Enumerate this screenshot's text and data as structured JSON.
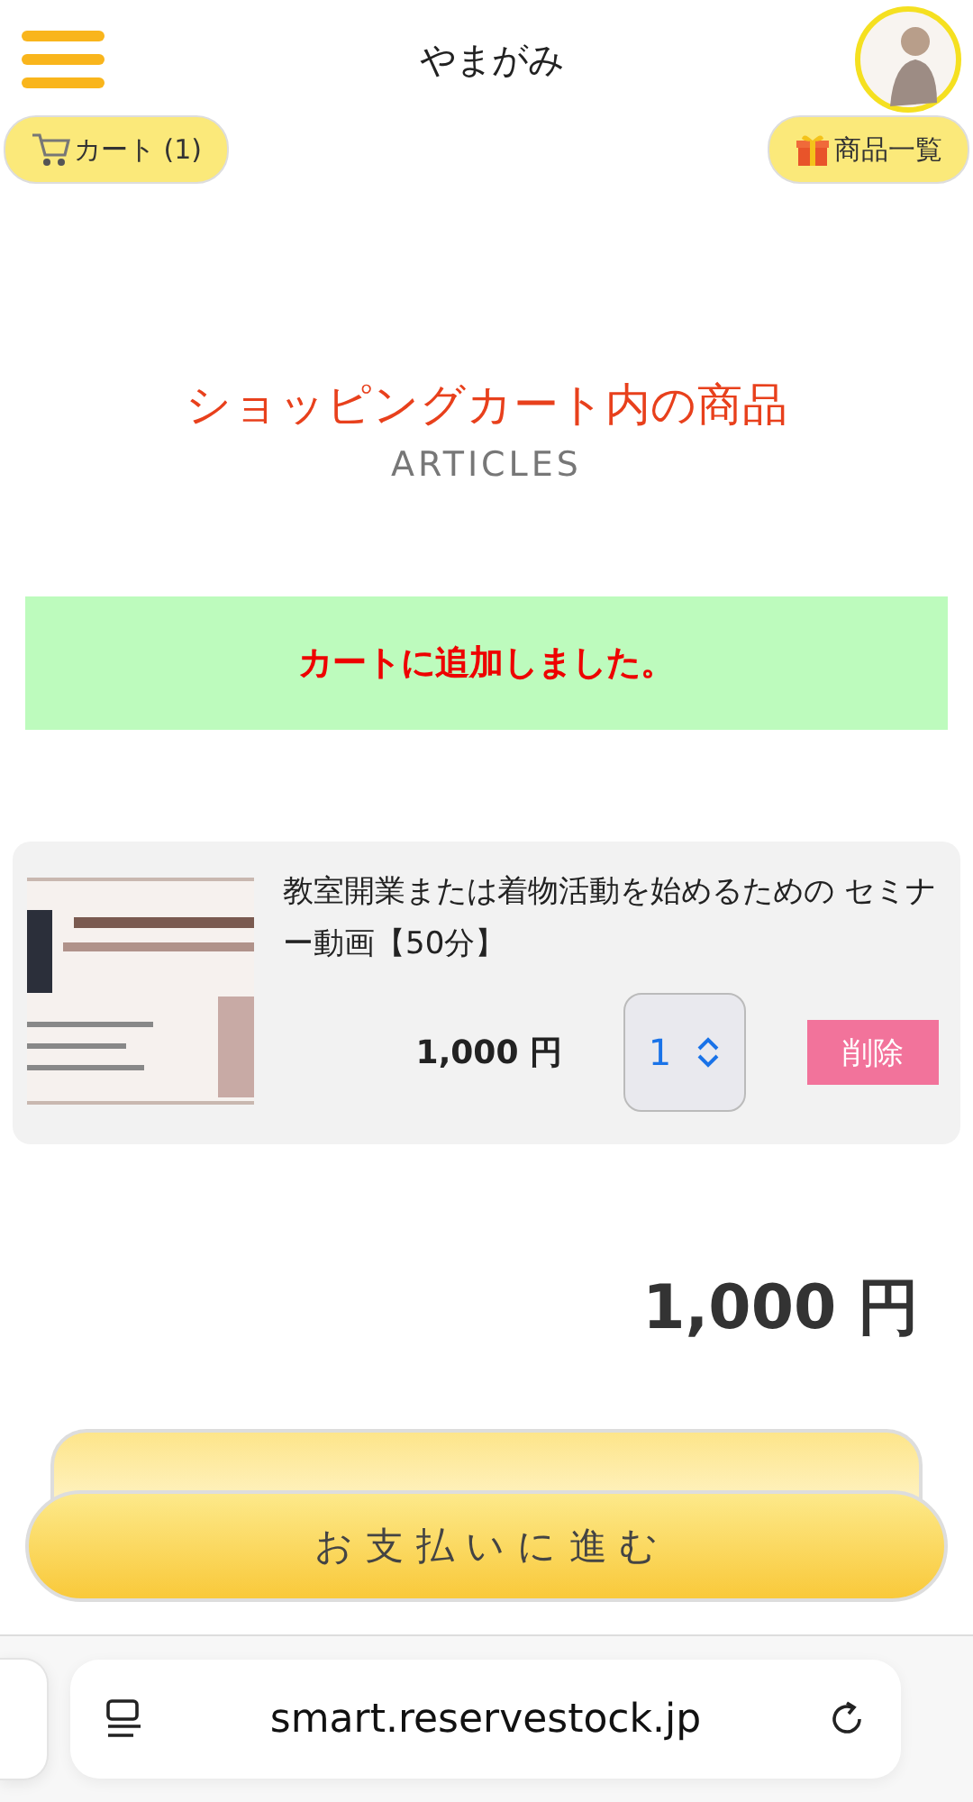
{
  "header": {
    "title": "やまがみ",
    "cart_button": "カート (1)",
    "products_button": "商品一覧"
  },
  "heading": {
    "title": "ショッピングカート内の商品",
    "subtitle": "ARTICLES"
  },
  "notice": "カートに追加しました。",
  "cart_items": [
    {
      "name": "教室開業または着物活動を始めるための セミナー動画【50分】",
      "price": "1,000 円",
      "quantity": "1",
      "delete_label": "削除"
    }
  ],
  "total": "1,000 円",
  "checkout_button": "お 支 払 い に 進 む",
  "browser": {
    "url": "smart.reservestock.jp"
  }
}
